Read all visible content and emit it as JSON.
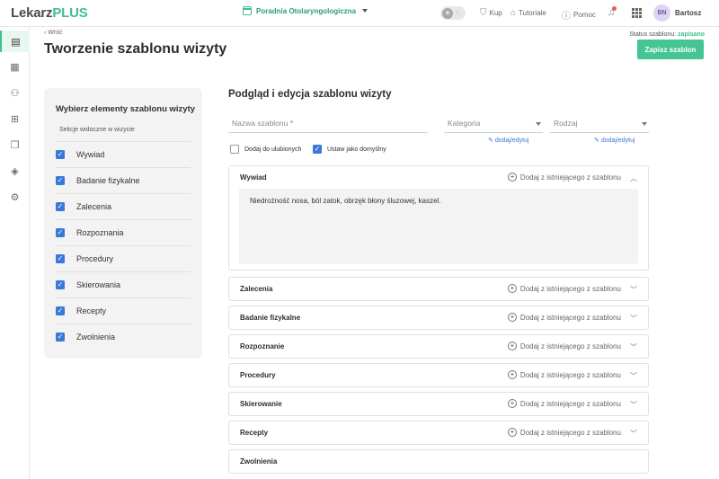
{
  "app": {
    "logo_part1": "Lekarz",
    "logo_part2": "PLUS"
  },
  "topbar": {
    "clinic": "Poradnia Otolaryngologiczna",
    "buy": "Kup",
    "tutorials": "Tutoriale",
    "help": "Pomoc",
    "user_initials": "BN",
    "user_name": "Bartosz"
  },
  "header": {
    "back": "Wróć",
    "title": "Tworzenie szablonu wizyty",
    "status_label": "Status szablonu: ",
    "status_value": "zapisano",
    "save_button": "Zapisz szablon"
  },
  "panel": {
    "title": "Wybierz elementy szablonu wizyty",
    "subtitle": "Sekcje widoczne w wizycie",
    "items": [
      {
        "label": "Wywiad",
        "checked": true
      },
      {
        "label": "Badanie fizykalne",
        "checked": true
      },
      {
        "label": "Zalecenia",
        "checked": true
      },
      {
        "label": "Rozpoznania",
        "checked": true
      },
      {
        "label": "Procedury",
        "checked": true
      },
      {
        "label": "Skierowania",
        "checked": true
      },
      {
        "label": "Recepty",
        "checked": true
      },
      {
        "label": "Zwolnienia",
        "checked": true
      }
    ]
  },
  "preview": {
    "title": "Podgląd i edycja szablonu wizyty",
    "name_placeholder": "Nazwa szablonu",
    "required_mark": "*",
    "category_placeholder": "Kategoria",
    "type_placeholder": "Rodzaj",
    "add_edit": "dodaj/edytuj",
    "favorites_label": "Dodaj do ulubionych",
    "favorites_checked": false,
    "default_label": "Ustaw jako domyślny",
    "default_checked": true,
    "add_from_template": "Dodaj z istniejącego z szablonu",
    "sections": [
      {
        "name": "Wywiad",
        "expanded": true,
        "content": "Niedrożność nosa, ból zatok, obrzęk błony śluzowej, kaszel."
      },
      {
        "name": "Zalecenia",
        "expanded": false
      },
      {
        "name": "Badanie fizykalne",
        "expanded": false
      },
      {
        "name": "Rozpoznanie",
        "expanded": false
      },
      {
        "name": "Procedury",
        "expanded": false
      },
      {
        "name": "Skierowanie",
        "expanded": false
      },
      {
        "name": "Recepty",
        "expanded": false
      },
      {
        "name": "Zwolnienia",
        "expanded": false
      }
    ]
  },
  "colors": {
    "brand": "#3fbf8f",
    "checkbox": "#3b78d8",
    "save_button": "#46c594"
  }
}
